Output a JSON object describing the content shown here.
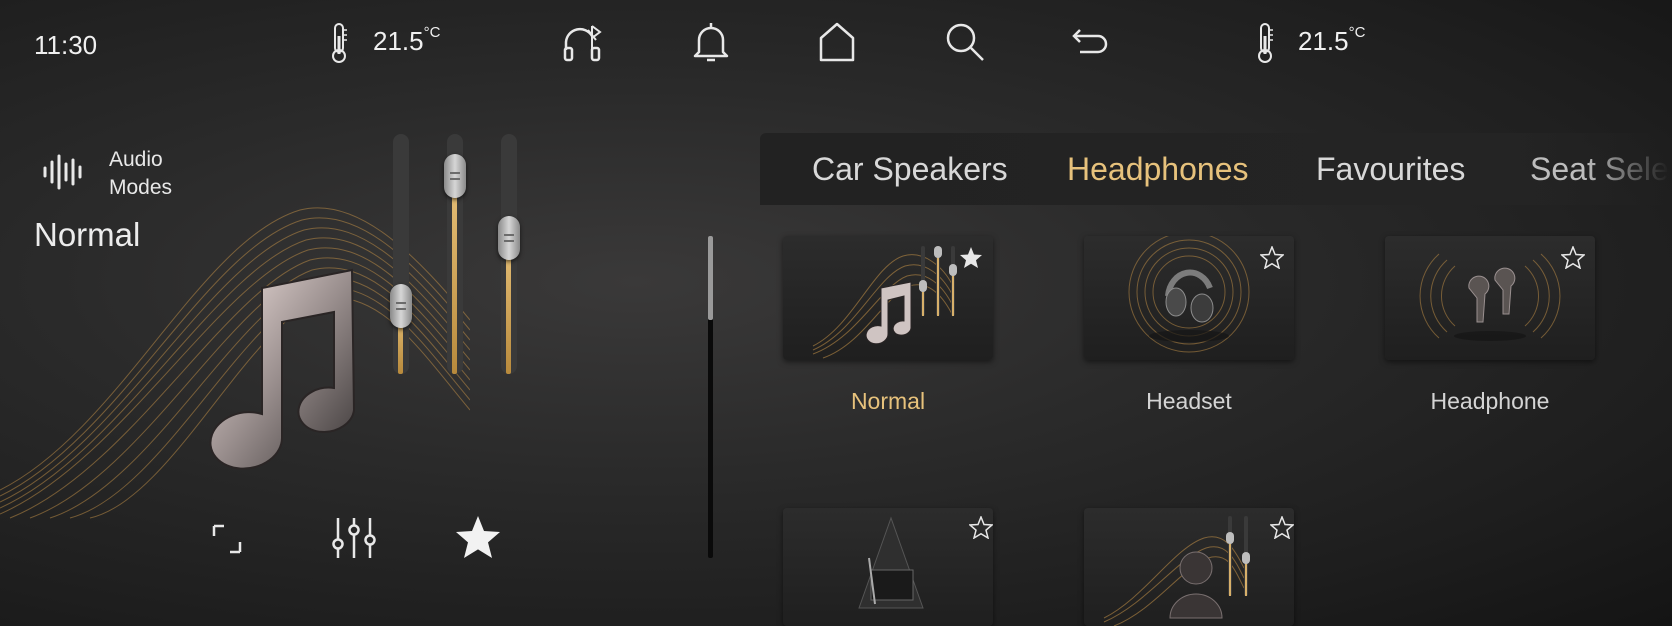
{
  "status_bar": {
    "time": "11:30",
    "temp_left": "21.5",
    "temp_right": "21.5",
    "temp_unit": "°C",
    "icons": [
      "thermometer-icon",
      "bluetooth-headset-icon",
      "bell-icon",
      "home-icon",
      "search-icon",
      "return-icon",
      "thermometer-icon"
    ]
  },
  "audio_modes": {
    "label_line1": "Audio",
    "label_line2": "Modes",
    "current_mode": "Normal",
    "sliders": [
      0.35,
      0.92,
      0.6
    ],
    "actions": [
      "expand-icon",
      "equalizer-icon",
      "star-icon"
    ]
  },
  "tabs": [
    {
      "label": "Car Speakers"
    },
    {
      "label": "Headphones",
      "active": true
    },
    {
      "label": "Favourites"
    },
    {
      "label": "Seat Sele"
    }
  ],
  "cards": [
    {
      "label": "Normal",
      "active": true,
      "favourite": true
    },
    {
      "label": "Headset",
      "active": false,
      "favourite": false
    },
    {
      "label": "Headphone",
      "active": false,
      "favourite": false
    },
    {
      "label": "",
      "active": false,
      "favourite": false
    },
    {
      "label": "",
      "active": false,
      "favourite": false
    }
  ],
  "colors": {
    "accent": "#e7c27c",
    "text": "#e6e6e6",
    "background": "#2a2a2a"
  }
}
